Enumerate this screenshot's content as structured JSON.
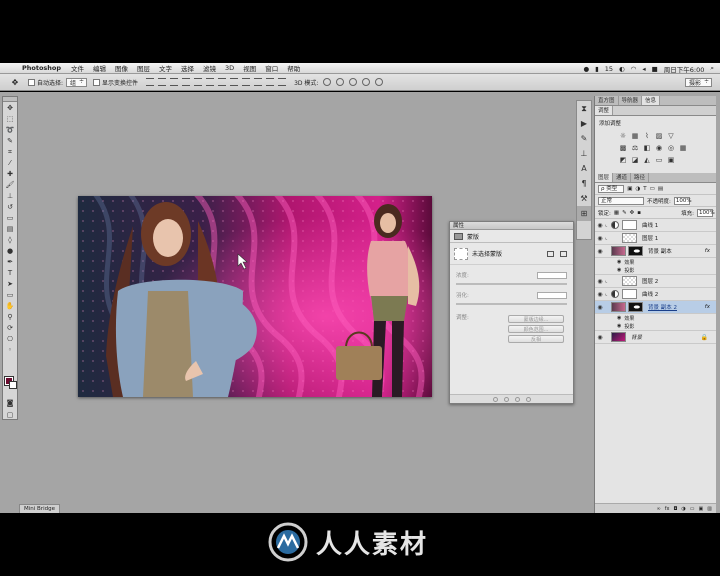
{
  "menubar": {
    "app": "Photoshop",
    "items": [
      "文件",
      "编辑",
      "图像",
      "图层",
      "文字",
      "选择",
      "滤镜",
      "3D",
      "视图",
      "窗口",
      "帮助"
    ],
    "status": {
      "battery_count": "15",
      "clock": "周日下午6:00"
    }
  },
  "optionsbar": {
    "auto_select_label": "自动选择:",
    "auto_select_value": "组",
    "show_transform_label": "显示变换控件",
    "mode3d_label": "3D 模式:",
    "workspace_value": "摄影"
  },
  "properties": {
    "title": "属性",
    "section": "蒙版",
    "mask_label": "未选择蒙版",
    "density_label": "浓度:",
    "feather_label": "羽化:",
    "refine_label": "调整:",
    "buttons": [
      "蒙版边缘...",
      "颜色范围...",
      "反相"
    ]
  },
  "dock": {
    "top_tabs": [
      "直方图",
      "导航器",
      "信息"
    ],
    "adjust_tab": "调整",
    "adjust_label": "添加调整",
    "layer_tabs": [
      "图层",
      "通道",
      "路径"
    ],
    "kind_filter": "ρ 类型",
    "blend_mode": "正常",
    "opacity_label": "不透明度:",
    "opacity_value": "100%",
    "lock_label": "锁定:",
    "fill_label": "填充:",
    "fill_value": "100%",
    "layers": [
      {
        "name": "曲线 1",
        "type": "adjust"
      },
      {
        "name": "图层 1",
        "type": "checker"
      },
      {
        "name": "背景 副本",
        "type": "photo",
        "fx": "fx"
      },
      {
        "name": "效果",
        "type": "effect"
      },
      {
        "name": "投影",
        "type": "effect"
      },
      {
        "name": "图层 2",
        "type": "checker"
      },
      {
        "name": "曲线 2",
        "type": "adjust"
      },
      {
        "name": "背景 副本 2",
        "type": "photo",
        "fx": "fx",
        "active": true
      },
      {
        "name": "效果",
        "type": "effect"
      },
      {
        "name": "投影",
        "type": "effect"
      },
      {
        "name": "背景",
        "type": "bg"
      }
    ]
  },
  "minibridge": "Mini Bridge",
  "watermark": "人人素材",
  "colors": {
    "foreground": "#6b0a2e",
    "canvas_pink": "#c2187a",
    "canvas_dark": "#241c38"
  }
}
